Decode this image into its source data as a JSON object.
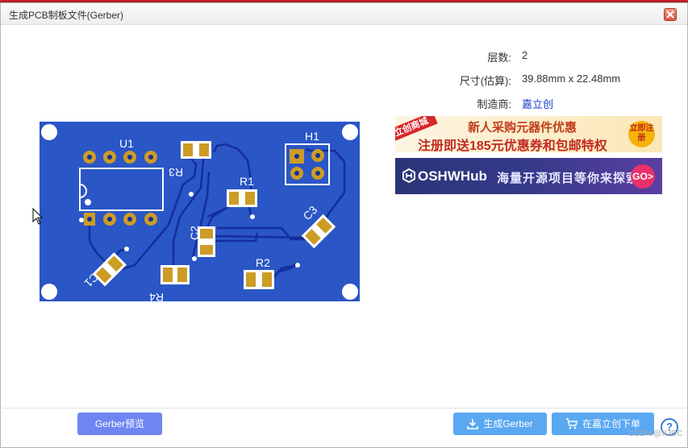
{
  "dialog": {
    "title": "生成PCB制板文件(Gerber)"
  },
  "info": {
    "layers_label": "层数:",
    "layers_value": "2",
    "size_label": "尺寸(估算):",
    "size_value": "39.88mm x 22.48mm",
    "maker_label": "制造商:",
    "maker_value": "嘉立创"
  },
  "pcb": {
    "labels": {
      "u1": "U1",
      "h1": "H1",
      "r1": "R1",
      "r2": "R2",
      "r3": "R3",
      "r4": "R4",
      "c1": "C1",
      "c2": "C2",
      "c3": "C3"
    },
    "colors": {
      "board": "#2a56c6",
      "trace": "#142e9c",
      "pad": "#cc9c25",
      "silk": "#ffffff"
    }
  },
  "ads": {
    "ad1": {
      "tag": "立创商城",
      "line1": "新人采购元器件优惠",
      "line2": "注册即送185元优惠券和包邮特权",
      "button": "立即注册"
    },
    "ad2": {
      "brand": "OSHWHub",
      "text": "海量开源项目等你来探索",
      "button": "GO>"
    }
  },
  "footer": {
    "preview_button": "Gerber预览",
    "generate_button": "生成Gerber",
    "order_button": "在嘉立创下单",
    "watermark": "CSDN @XJDC"
  }
}
